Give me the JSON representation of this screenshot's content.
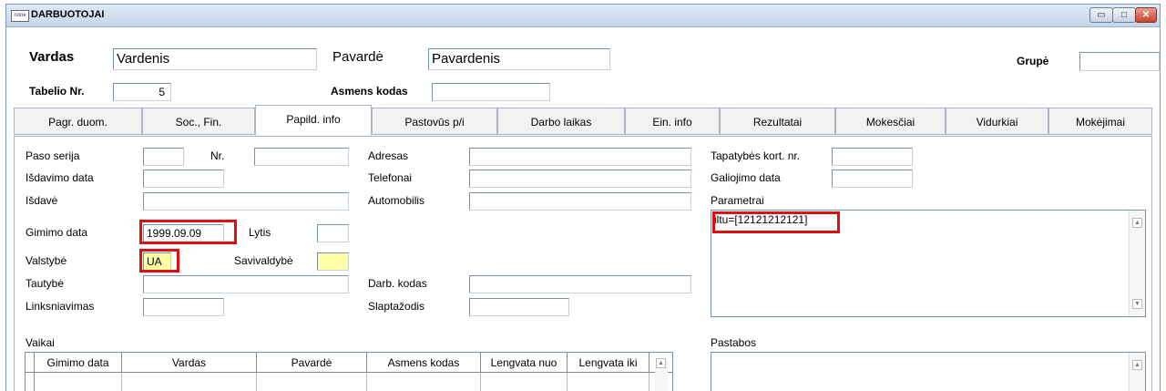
{
  "window": {
    "title": "DARBUOTOJAI",
    "app_icon_text": "none",
    "controls": {
      "minimize": "▭",
      "maximize": "□",
      "close": "✕"
    }
  },
  "header": {
    "vardas_label": "Vardas",
    "vardas_value": "Vardenis",
    "pavarde_label": "Pavardė",
    "pavarde_value": "Pavardenis",
    "grupe_label": "Grupė",
    "grupe_value": "",
    "tabelio_label": "Tabelio Nr.",
    "tabelio_value": "5",
    "asmens_kodas_label": "Asmens kodas",
    "asmens_kodas_value": ""
  },
  "tabs": [
    {
      "label": "Pagr. duom.",
      "active": false
    },
    {
      "label": "Soc., Fin.",
      "active": false
    },
    {
      "label": "Papild. info",
      "active": true
    },
    {
      "label": "Pastovūs p/i",
      "active": false
    },
    {
      "label": "Darbo laikas",
      "active": false
    },
    {
      "label": "Ein. info",
      "active": false
    },
    {
      "label": "Rezultatai",
      "active": false
    },
    {
      "label": "Mokesčiai",
      "active": false
    },
    {
      "label": "Vidurkiai",
      "active": false
    },
    {
      "label": "Mokėjimai",
      "active": false
    }
  ],
  "form": {
    "paso_serija_label": "Paso serija",
    "paso_serija_value": "",
    "nr_label": "Nr.",
    "nr_value": "",
    "isdavimo_data_label": "Išdavimo data",
    "isdavimo_data_value": "",
    "isdave_label": "Išdavė",
    "isdave_value": "",
    "gimimo_data_label": "Gimimo data",
    "gimimo_data_value": "1999.09.09",
    "lytis_label": "Lytis",
    "lytis_value": "",
    "valstybe_label": "Valstybė",
    "valstybe_value": "UA",
    "savivaldybe_label": "Savivaldybė",
    "savivaldybe_value": "",
    "tautybe_label": "Tautybė",
    "tautybe_value": "",
    "linksniavimas_label": "Linksniavimas",
    "linksniavimas_value": "",
    "adresas_label": "Adresas",
    "adresas_value": "",
    "telefonai_label": "Telefonai",
    "telefonai_value": "",
    "automobilis_label": "Automobilis",
    "automobilis_value": "",
    "darb_kodas_label": "Darb. kodas",
    "darb_kodas_value": "",
    "slaptazodis_label": "Slaptažodis",
    "slaptazodis_value": "",
    "tapatybes_label": "Tapatybės kort. nr.",
    "tapatybes_value": "",
    "galiojimo_label": "Galiojimo data",
    "galiojimo_value": "",
    "parametrai_label": "Parametrai",
    "parametrai_value": "iltu=[12121212121]",
    "pastabos_label": "Pastabos",
    "pastabos_value": ""
  },
  "children": {
    "label": "Vaikai",
    "columns": [
      "Gimimo data",
      "Vardas",
      "Pavardė",
      "Asmens kodas",
      "Lengvata nuo",
      "Lengvata iki"
    ]
  },
  "colors": {
    "highlight": "#e01010",
    "yellow_field": "#ffffa8",
    "titlebar": "#c5d6ea"
  }
}
